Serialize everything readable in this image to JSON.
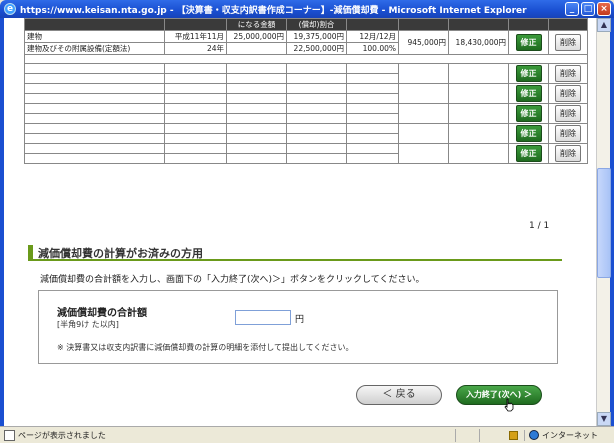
{
  "window": {
    "title": "https://www.keisan.nta.go.jp - 【決算書・収支内訳書作成コーナー】-減価償却費 - Microsoft Internet Explorer",
    "min_label": "_",
    "max_label": "□",
    "close_label": "×"
  },
  "table": {
    "header": [
      "",
      "",
      "になる金額",
      "(償却)割合",
      "",
      "",
      ""
    ],
    "rows": [
      {
        "name": "建物",
        "date": "平成11年11月",
        "cost": "25,000,000円",
        "basis": "19,375,000円",
        "ratio": "12月/12月",
        "depr": "945,000円",
        "balance": "18,430,000円"
      },
      {
        "name": "建物及びその附属設備(定額法)",
        "date": "24年",
        "cost": "",
        "basis": "22,500,000円",
        "ratio": "100.00%",
        "depr": "",
        "balance": ""
      }
    ],
    "edit_label": "修正",
    "delete_label": "削除"
  },
  "pager": "1 / 1",
  "section": {
    "heading": "減価償却費の計算がお済みの方用",
    "instruction": "減価償却費の合計額を入力し、画面下の「入力終了(次へ)＞」ボタンをクリックしてください。",
    "field_label": "減価償却費の合計額",
    "field_hint": "[半角9け た以内]",
    "field_value": "",
    "unit": "円",
    "note": "※ 決算書又は収支内訳書に減価償却費の計算の明細を添付して提出してください。"
  },
  "buttons": {
    "back": "＜ 戻る",
    "next": "入力終了(次へ) ＞"
  },
  "status": {
    "text": "ページが表示されました",
    "zone": "インターネット"
  }
}
